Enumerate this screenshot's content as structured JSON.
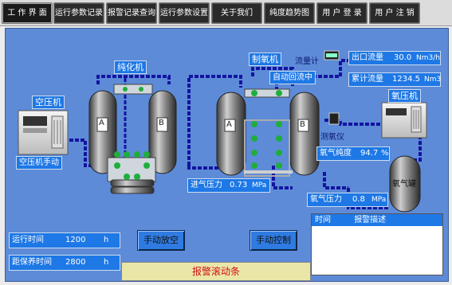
{
  "nav": {
    "items": [
      "工 作 界 面",
      "运行参数记录",
      "报警记录查询",
      "运行参数设置",
      "关于我们",
      "纯度趋势图",
      "用 户 登 录",
      "用 户 注 销"
    ]
  },
  "process": {
    "compressor_label": "空压机",
    "compressor_mode": "空压机手动",
    "purifier_label": "纯化机",
    "generator_label": "制氧机",
    "tower_a": "A",
    "tower_b": "B",
    "flowmeter_label": "流量计",
    "auto_return": "自动回流中",
    "analyzer_label": "测氧仪",
    "o2_compressor_label": "氧压机",
    "o2_tank_label": "氧气罐"
  },
  "readouts": {
    "outlet_flow": {
      "label": "出口流量",
      "value": "30.0",
      "unit": "Nm3/h"
    },
    "total_flow": {
      "label": "累计流量",
      "value": "1234.5",
      "unit": "Nm3"
    },
    "purity": {
      "label": "氧气纯度",
      "value": "94.7",
      "unit": "%"
    },
    "inlet_pressure": {
      "label": "进气压力",
      "value": "0.73",
      "unit": "MPa"
    },
    "o2_pressure": {
      "label": "氧气压力",
      "value": "0.8",
      "unit": "MPa"
    },
    "run_time": {
      "label": "运行时间",
      "value": "1200",
      "unit": "h"
    },
    "maintenance_time": {
      "label": "距保养时间",
      "value": "2800",
      "unit": "h"
    }
  },
  "controls": {
    "manual_release": "手动放空",
    "manual_control": "手动控制"
  },
  "alarm": {
    "ticker": "报警滚动条",
    "col_time": "时间",
    "col_desc": "报警描述"
  },
  "colors": {
    "background": "#5d8bd8",
    "pipe": "#1414a0",
    "panel": "#1e78e6",
    "valve_green": "#1fae3c",
    "alarm_text": "#d01010"
  }
}
